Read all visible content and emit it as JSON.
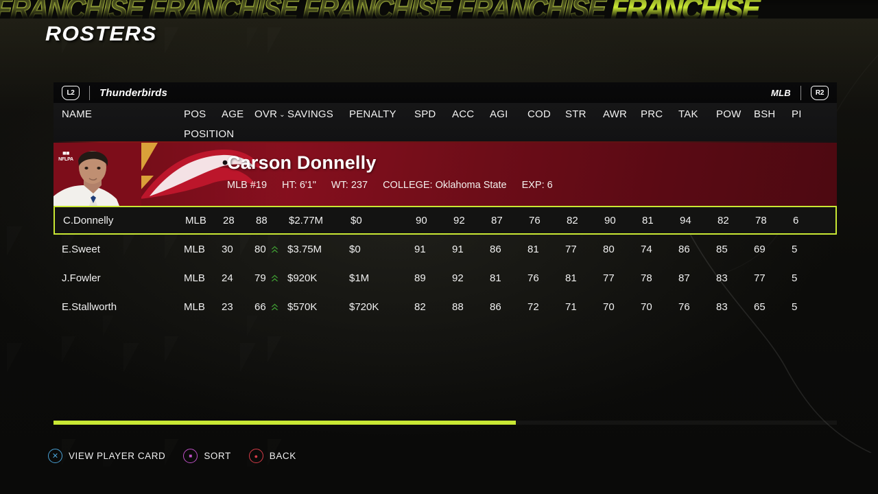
{
  "marquee": {
    "repeat_text": "FRANCHISE",
    "outline_repeats": 4,
    "fill_text": "FRANCHISE"
  },
  "page": {
    "title": "ROSTERS"
  },
  "tabbar": {
    "left_button": "L2",
    "right_button": "R2",
    "team_name": "Thunderbirds",
    "position_filter": "MLB"
  },
  "table": {
    "headers": {
      "name": "NAME",
      "pos": "POS",
      "age": "AGE",
      "ovr": "OVR",
      "savings": "SAVINGS",
      "penalty": "PENALTY",
      "stats": [
        "SPD",
        "ACC",
        "AGI",
        "COD",
        "STR",
        "AWR",
        "PRC",
        "TAK",
        "POW",
        "BSH",
        "PI"
      ]
    },
    "subheaders": {
      "pos": "POSITION"
    },
    "sort_caret": "⌄",
    "rows": [
      {
        "name": "C.Donnelly",
        "pos": "MLB",
        "age": "28",
        "ovr": "88",
        "trending_up": false,
        "savings": "$2.77M",
        "penalty": "$0",
        "stats": [
          "90",
          "92",
          "87",
          "76",
          "82",
          "90",
          "81",
          "94",
          "82",
          "78",
          "6"
        ],
        "selected": true
      },
      {
        "name": "E.Sweet",
        "pos": "MLB",
        "age": "30",
        "ovr": "80",
        "trending_up": true,
        "savings": "$3.75M",
        "penalty": "$0",
        "stats": [
          "91",
          "91",
          "86",
          "81",
          "77",
          "80",
          "74",
          "86",
          "85",
          "69",
          "5"
        ],
        "selected": false
      },
      {
        "name": "J.Fowler",
        "pos": "MLB",
        "age": "24",
        "ovr": "79",
        "trending_up": true,
        "savings": "$920K",
        "penalty": "$1M",
        "stats": [
          "89",
          "92",
          "81",
          "76",
          "81",
          "77",
          "78",
          "87",
          "83",
          "77",
          "5"
        ],
        "selected": false
      },
      {
        "name": "E.Stallworth",
        "pos": "MLB",
        "age": "23",
        "ovr": "66",
        "trending_up": true,
        "savings": "$570K",
        "penalty": "$720K",
        "stats": [
          "82",
          "88",
          "86",
          "72",
          "71",
          "70",
          "70",
          "76",
          "83",
          "65",
          "5"
        ],
        "selected": false
      }
    ]
  },
  "player_card": {
    "name": "Carson Donnelly",
    "position_number": "MLB #19",
    "height": "HT: 6'1\"",
    "weight": "WT: 237",
    "college": "COLLEGE: Oklahoma State",
    "experience": "EXP: 6",
    "badge": "NFLPA"
  },
  "scrollbar": {
    "fill_percent": 59
  },
  "legend": [
    {
      "button": "cross",
      "glyph": "✕",
      "label": "VIEW PLAYER CARD",
      "color": "#4aa3d8"
    },
    {
      "button": "square",
      "glyph": "■",
      "label": "SORT",
      "color": "#c050c8"
    },
    {
      "button": "circle",
      "glyph": "●",
      "label": "BACK",
      "color": "#d83c48"
    }
  ],
  "colors": {
    "accent_green": "#c9e834",
    "card_red": "#8e1020",
    "trend_up_green": "#3f9b33",
    "panel_dark": "#131312"
  }
}
